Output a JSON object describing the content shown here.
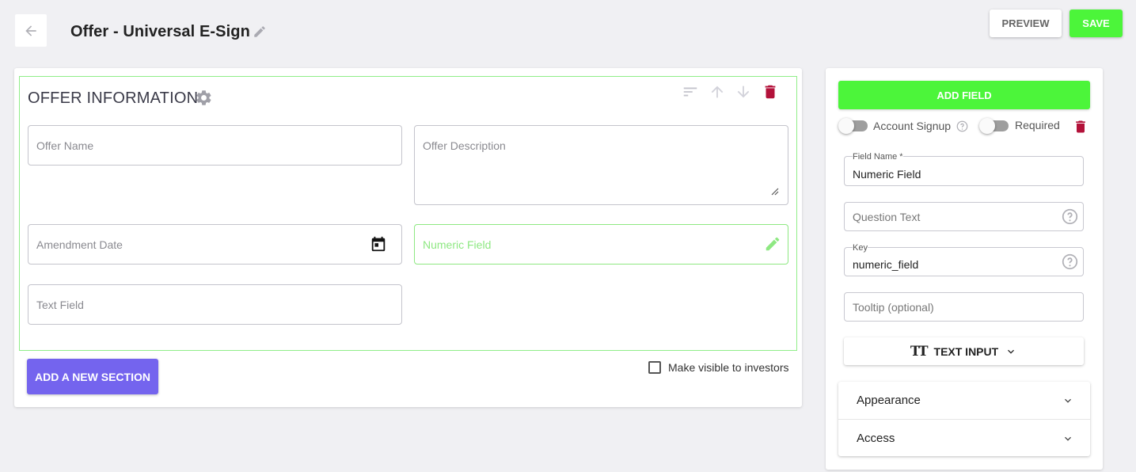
{
  "header": {
    "title": "Offer - Universal E-Sign",
    "preview_label": "PREVIEW",
    "save_label": "SAVE"
  },
  "section": {
    "title": "OFFER INFORMATION",
    "fields": {
      "offer_name": "Offer Name",
      "offer_description": "Offer Description",
      "amendment_date": "Amendment Date",
      "numeric_field": "Numeric Field",
      "text_field": "Text Field"
    }
  },
  "footer": {
    "add_section_label": "ADD A NEW SECTION",
    "visible_label": "Make visible to investors"
  },
  "panel": {
    "add_field_label": "ADD FIELD",
    "account_signup_label": "Account Signup",
    "required_label": "Required",
    "field_name_label": "Field Name *",
    "field_name_value": "Numeric Field",
    "question_text_placeholder": "Question Text",
    "key_label": "Key",
    "key_value": "numeric_field",
    "tooltip_placeholder": "Tooltip (optional)",
    "input_type_label": "TEXT INPUT",
    "input_type_glyph": "TT",
    "accordion": [
      "Appearance",
      "Access"
    ]
  },
  "colors": {
    "accent_green": "#4cf53a",
    "active_border": "#8ee882",
    "purple": "#7464ee",
    "danger": "#b3123a"
  }
}
